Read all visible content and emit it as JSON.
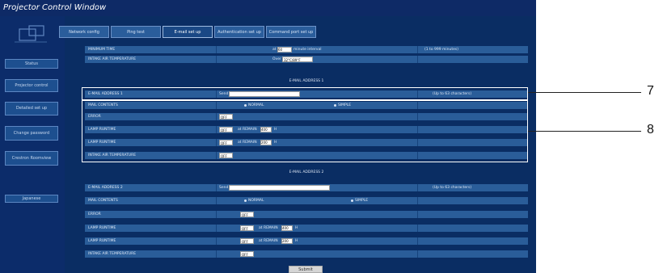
{
  "window": {
    "title": "Projector Control Window"
  },
  "sidebar": {
    "items": [
      {
        "label": "Status"
      },
      {
        "label": "Projector control"
      },
      {
        "label": "Detailed set up"
      },
      {
        "label": "Change password"
      },
      {
        "label": "Crestron Roomview"
      },
      {
        "label": "Japanese"
      }
    ]
  },
  "tabs": [
    {
      "label": "Network config"
    },
    {
      "label": "Ping test"
    },
    {
      "label": "E-mail set up"
    },
    {
      "label": "Authentication set up"
    },
    {
      "label": "Command port set up"
    }
  ],
  "top": {
    "minimum_time": {
      "label": "MINIMUM TIME",
      "prefix": "at",
      "value": "60",
      "unit": "minute interval",
      "range": "(1 to 999 minutes)"
    },
    "intake_air": {
      "label": "INTAKE AIR TEMPERATURE",
      "prefix": "Over",
      "value": "32°C/89°F"
    }
  },
  "email1": {
    "header": "E-MAIL ADDRESS 1",
    "address": {
      "label": "E-MAIL ADDRESS 1",
      "prefix": "Send to",
      "value": "",
      "note": "(Up to 63 characters)"
    },
    "contents": {
      "label": "MAIL CONTENTS",
      "opt1": "NORMAL",
      "opt2": "SIMPLE"
    },
    "error": {
      "label": "ERROR",
      "value": "OFF"
    },
    "lamp1": {
      "label": "LAMP RUNTIME",
      "value": "OFF",
      "remain_label": "at REMAIN",
      "hours": "400",
      "unit": "H"
    },
    "lamp2": {
      "label": "LAMP RUNTIME",
      "value": "OFF",
      "remain_label": "at REMAIN",
      "hours": "200",
      "unit": "H"
    },
    "intake": {
      "label": "INTAKE AIR TEMPERATURE",
      "value": "OFF"
    }
  },
  "email2": {
    "header": "E-MAIL ADDRESS 2",
    "address": {
      "label": "E-MAIL ADDRESS 2",
      "prefix": "Send to",
      "value": "",
      "note": "(Up to 63 characters)"
    },
    "contents": {
      "label": "MAIL CONTENTS",
      "opt1": "NORMAL",
      "opt2": "SIMPLE"
    },
    "error": {
      "label": "ERROR",
      "value": "OFF"
    },
    "lamp1": {
      "label": "LAMP RUNTIME",
      "value": "OFF",
      "remain_label": "at REMAIN",
      "hours": "400",
      "unit": "H"
    },
    "lamp2": {
      "label": "LAMP RUNTIME",
      "value": "OFF",
      "remain_label": "at REMAIN",
      "hours": "200",
      "unit": "H"
    },
    "intake": {
      "label": "INTAKE AIR TEMPERATURE",
      "value": "OFF"
    }
  },
  "submit": {
    "label": "Submit"
  },
  "callouts": [
    {
      "num": "7"
    },
    {
      "num": "8"
    }
  ]
}
